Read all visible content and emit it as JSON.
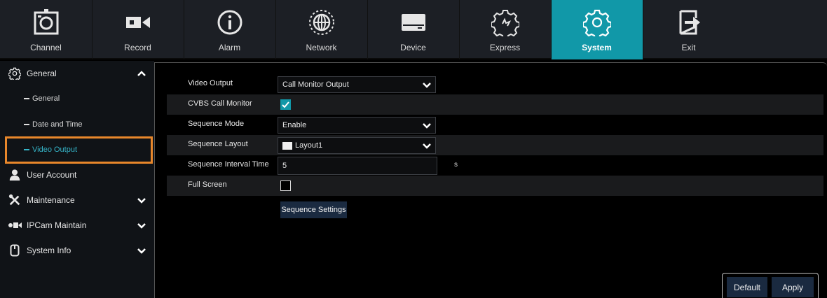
{
  "nav": {
    "items": [
      {
        "label": "Channel",
        "icon": "channel-camera-icon"
      },
      {
        "label": "Record",
        "icon": "record-camcorder-icon"
      },
      {
        "label": "Alarm",
        "icon": "alarm-info-icon"
      },
      {
        "label": "Network",
        "icon": "network-globe-icon"
      },
      {
        "label": "Device",
        "icon": "device-hdd-icon"
      },
      {
        "label": "Express",
        "icon": "express-gear-icon"
      },
      {
        "label": "System",
        "icon": "system-gear-icon"
      },
      {
        "label": "Exit",
        "icon": "exit-icon"
      }
    ],
    "active_index": 6,
    "active_color": "#1198a8"
  },
  "sidebar": {
    "general": "General",
    "general_sub": "General",
    "date_time": "Date and Time",
    "video_output": "Video Output",
    "user_account": "User Account",
    "maintenance": "Maintenance",
    "ipcam_maintain": "IPCam Maintain",
    "system_info": "System Info",
    "highlight_color": "#e8872b"
  },
  "form": {
    "video_output_label": "Video Output",
    "video_output_value": "Call Monitor Output",
    "cvbs_label": "CVBS Call Monitor",
    "cvbs_checked": true,
    "sequence_mode_label": "Sequence Mode",
    "sequence_mode_value": "Enable",
    "sequence_layout_label": "Sequence Layout",
    "sequence_layout_value": "Layout1",
    "interval_label": "Sequence Interval Time",
    "interval_value": "5",
    "interval_unit": "s",
    "full_screen_label": "Full Screen",
    "full_screen_checked": false,
    "sequence_settings_button": "Sequence Settings"
  },
  "buttons": {
    "default": "Default",
    "apply": "Apply"
  }
}
